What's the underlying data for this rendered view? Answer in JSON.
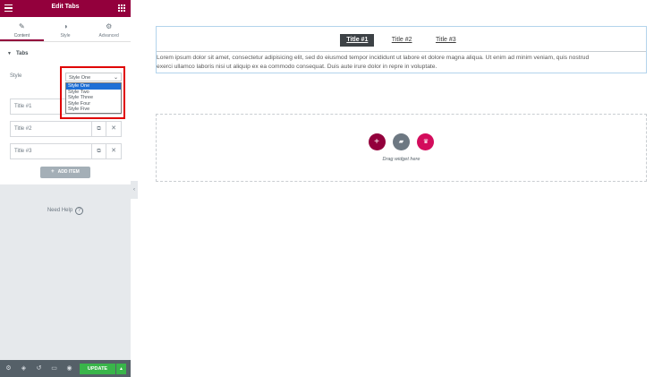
{
  "header": {
    "title": "Edit Tabs",
    "menu_icon": "hamburger-icon",
    "grid_icon": "apps-grid-icon"
  },
  "panel_tabs": [
    {
      "label": "Content",
      "icon": "pencil-icon",
      "glyph": "✎"
    },
    {
      "label": "Style",
      "icon": "half-circle-icon",
      "glyph": "◑"
    },
    {
      "label": "Advanced",
      "icon": "gear-icon",
      "glyph": "⚙"
    }
  ],
  "section": {
    "title": "Tabs"
  },
  "style_control": {
    "label": "Style",
    "selected": "Style One",
    "options": [
      "Style One",
      "Style Two",
      "Style Three",
      "Style Four",
      "Style Five"
    ]
  },
  "repeater": {
    "items": [
      "Title #1",
      "Title #2",
      "Title #3"
    ],
    "add_label": "ADD ITEM"
  },
  "help": {
    "label": "Need Help",
    "glyph": "?"
  },
  "footer": {
    "update_label": "UPDATE"
  },
  "canvas": {
    "tab_titles": [
      "Title #1",
      "Title #2",
      "Title #3"
    ],
    "content_line1": "Lorem ipsum dolor sit amet, consectetur adipisicing elit, sed do eiusmod tempor incididunt ut labore et dolore magna aliqua. Ut enim ad minim veniam, quis nostrud",
    "content_line2": "exerci ullamco laboris nisi ut aliquip ex ea commodo consequat. Duis aute irure dolor in repre in voluptate.",
    "drop_text": "Drag widget here"
  },
  "colors": {
    "brand": "#93003c",
    "update": "#39b54a",
    "selected_option": "#1e6fd6",
    "highlight_box": "#e00000"
  }
}
